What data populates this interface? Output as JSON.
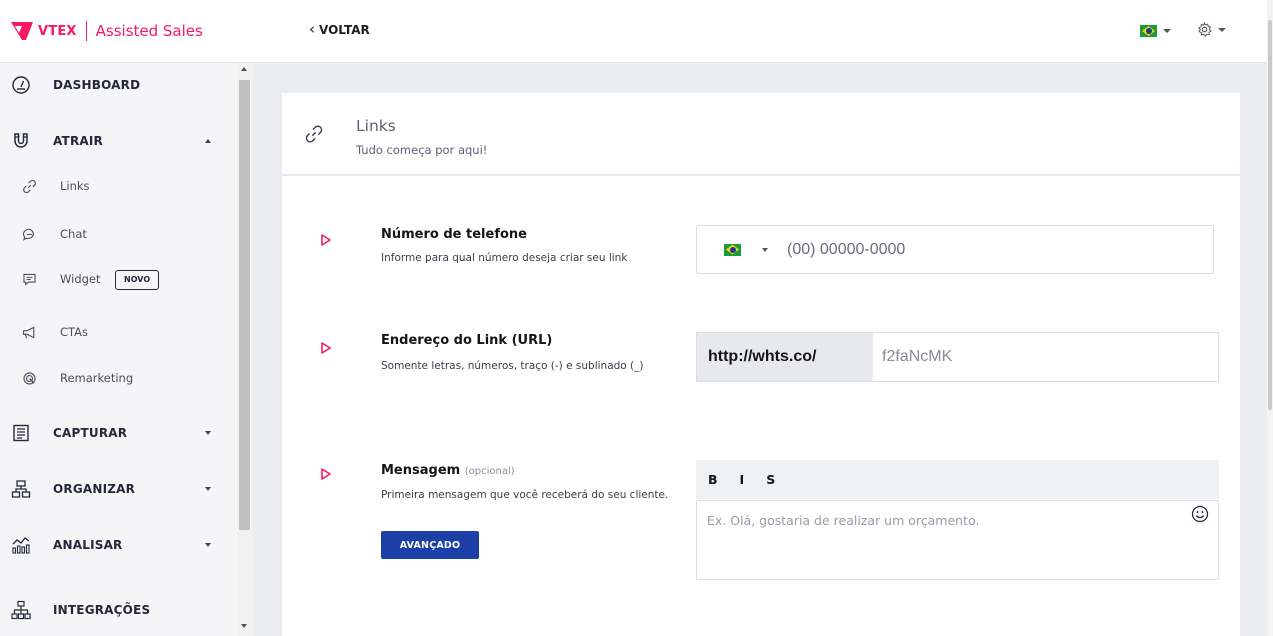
{
  "header": {
    "brand_name": "VTEX",
    "product_name": "Assisted Sales",
    "back_label": "VOLTAR",
    "language_flag": "brazil-flag-icon",
    "settings_icon": "gear-icon"
  },
  "sidebar": {
    "items": [
      {
        "label": "DASHBOARD",
        "icon": "dashboard-gauge-icon"
      },
      {
        "label": "ATRAIR",
        "icon": "magnet-icon",
        "expanded": true
      },
      {
        "label": "Links",
        "icon": "link-icon"
      },
      {
        "label": "Chat",
        "icon": "chat-bubble-icon"
      },
      {
        "label": "Widget",
        "icon": "widget-icon",
        "badge": "NOVO"
      },
      {
        "label": "CTAs",
        "icon": "megaphone-icon"
      },
      {
        "label": "Remarketing",
        "icon": "remarketing-icon"
      },
      {
        "label": "CAPTURAR",
        "icon": "form-icon"
      },
      {
        "label": "ORGANIZAR",
        "icon": "hierarchy-icon"
      },
      {
        "label": "ANALISAR",
        "icon": "analytics-icon"
      },
      {
        "label": "INTEGRAÇÕES",
        "icon": "network-icon"
      }
    ]
  },
  "card": {
    "title": "Links",
    "subtitle": "Tudo começa por aqui!",
    "phone": {
      "title": "Número de telefone",
      "description": "Informe para qual número deseja criar seu link",
      "placeholder": "(00) 00000-0000",
      "country_flag": "brazil-flag-icon"
    },
    "url": {
      "title": "Endereço do Link (URL)",
      "description": "Somente letras, números, traço (-) e sublinado (_)",
      "prefix": "http://whts.co/",
      "placeholder": "f2faNcMK"
    },
    "message": {
      "title": "Mensagem",
      "optional": "(opcional)",
      "description": "Primeira mensagem que você receberá do seu cliente.",
      "toolbar": {
        "bold": "B",
        "italic": "I",
        "strike": "S"
      },
      "placeholder": "Ex. Olá, gostaria de realizar um orçamento.",
      "advanced_button": "AVANÇADO"
    }
  },
  "colors": {
    "brand": "#f71963",
    "primary_button": "#1c3fa8",
    "sidebar_bg": "#f5f5f7",
    "page_bg": "#ebecef"
  }
}
